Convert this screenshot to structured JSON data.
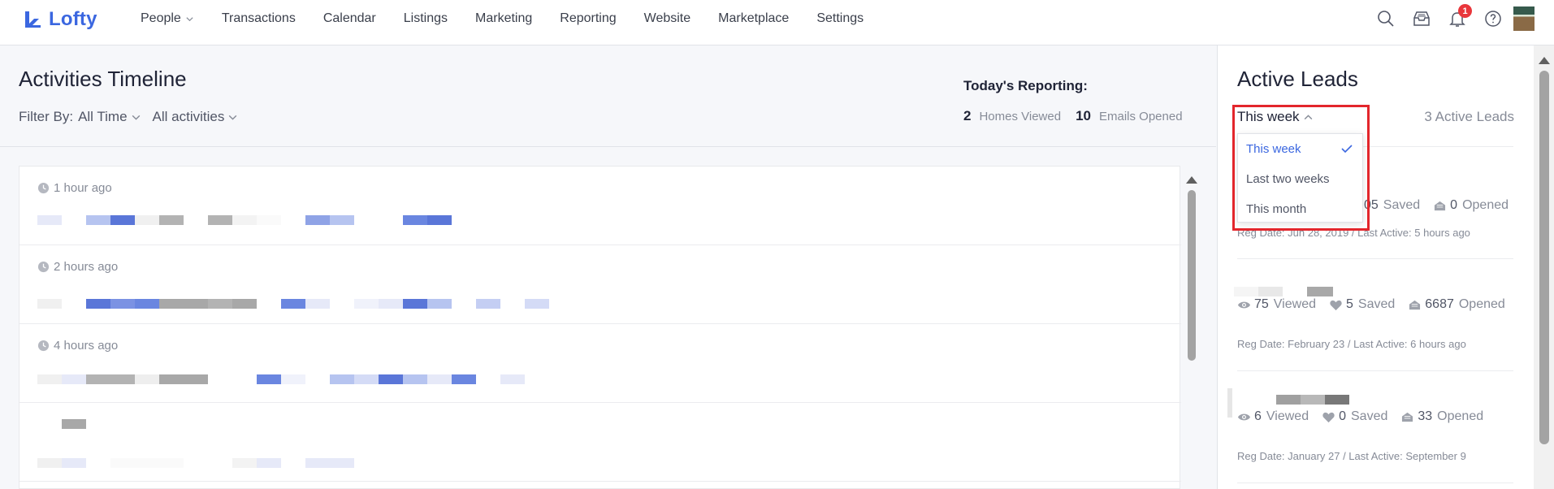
{
  "app": {
    "name": "Lofty",
    "brand_color": "#3b67e0"
  },
  "nav": {
    "items": [
      {
        "label": "People",
        "has_dropdown": true
      },
      {
        "label": "Transactions"
      },
      {
        "label": "Calendar"
      },
      {
        "label": "Listings"
      },
      {
        "label": "Marketing"
      },
      {
        "label": "Reporting"
      },
      {
        "label": "Website"
      },
      {
        "label": "Marketplace"
      },
      {
        "label": "Settings"
      }
    ],
    "icons": [
      "search-icon",
      "inbox-icon",
      "bell-icon",
      "help-icon"
    ],
    "notification_count": "1"
  },
  "timeline": {
    "title": "Activities Timeline",
    "filter_label": "Filter By:",
    "filter_time": "All Time",
    "filter_type": "All activities",
    "reporting": {
      "title": "Today's Reporting:",
      "homes_viewed": "2",
      "homes_viewed_label": "Homes Viewed",
      "emails_opened": "10",
      "emails_opened_label": "Emails Opened"
    },
    "items": [
      {
        "time": "1 hour ago"
      },
      {
        "time": "2 hours ago"
      },
      {
        "time": "4 hours ago"
      },
      {
        "time": ""
      }
    ]
  },
  "leads": {
    "title": "Active Leads",
    "period": "This week",
    "count_label": "3 Active Leads",
    "dropdown": {
      "options": [
        "This week",
        "Last two weeks",
        "This month"
      ],
      "selected": "This week"
    },
    "list": [
      {
        "viewed": "",
        "viewed_label": "",
        "saved": "05",
        "saved_label": "Saved",
        "opened": "0",
        "opened_label": "Opened",
        "meta": "Reg Date: Jun 28, 2019 / Last Active: 5 hours ago"
      },
      {
        "viewed": "75",
        "viewed_label": "Viewed",
        "saved": "5",
        "saved_label": "Saved",
        "opened": "6687",
        "opened_label": "Opened",
        "meta": "Reg Date: February 23 / Last Active: 6 hours ago"
      },
      {
        "viewed": "6",
        "viewed_label": "Viewed",
        "saved": "0",
        "saved_label": "Saved",
        "opened": "33",
        "opened_label": "Opened",
        "meta": "Reg Date: January 27 / Last Active: September 9"
      }
    ]
  },
  "colors": {
    "highlight": "#e3262c",
    "badge": "#e9363b"
  }
}
